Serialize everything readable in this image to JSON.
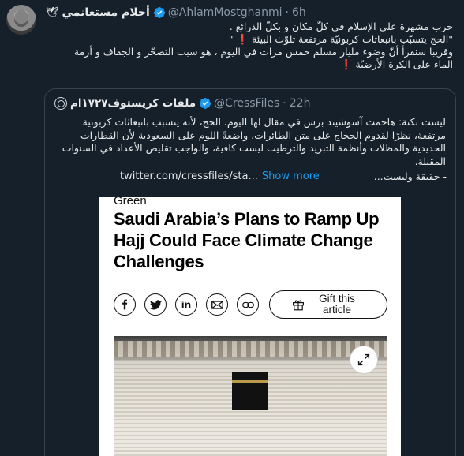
{
  "tweet": {
    "display_name": "أحلام مستغانمي",
    "handle": "@AhlamMostghanmi",
    "separator": "·",
    "time": "6h",
    "lines": [
      "حرب مشهرة على الإسلام  في كلّ مكان و بكلّ الذرائع .",
      "\"الحج يتسبّب بانبعاثات كربونيّة مرتفعة تلوّث البيئة",
      "وقريبا سنقرأ  أنّ  وضوء مليار مسلم خمس مرات في اليوم ، هو سبب التصحّر   و الجفاف و أزمة",
      "الماء على الكرة الأرضيّة"
    ],
    "emoji": "❗",
    "quote_mark": "\""
  },
  "quoted": {
    "display_name": "ملفات كريستوف١٧٢٧ام",
    "handle": "@CressFiles",
    "separator": "·",
    "time": "22h",
    "text": "ليست نكتة: هاجمت آسوشيتد برس في مقال لها اليوم، الحج، لأنه يتسبب بانبعاثات كربونية مرتفعة، نظرًا لقدوم الحجاج على متن الطائرات، واضعةً اللوم على السعودية لأن القطارات الحديدية والمظلات وأنظمة التبريد والترطيب ليست كافية، والواجب تقليص الأعداد في السنوات المقبلة.",
    "link": "twitter.com/cressfiles/sta...",
    "show_more": "Show more",
    "trailing": "- حقيقة وليست..."
  },
  "article": {
    "section": "Green",
    "headline": "Saudi Arabia’s Plans to Ramp Up Hajj Could Face Climate Change Challenges",
    "share_icons": [
      "facebook-icon",
      "twitter-icon",
      "linkedin-icon",
      "mail-icon",
      "link-icon"
    ],
    "linkedin_glyph": "in",
    "gift_label": "Gift this article"
  },
  "colors": {
    "background": "#15202b",
    "border": "#38444d",
    "muted": "#8b98a5",
    "accent": "#1d9bf0",
    "alert": "#e0245e"
  }
}
